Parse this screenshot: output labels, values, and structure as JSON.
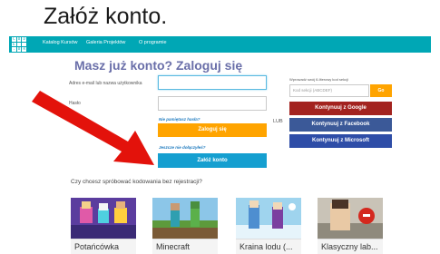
{
  "slide": {
    "title": "Załóż konto."
  },
  "nav": {
    "logo_letters": [
      "C",
      "O",
      "D",
      "E",
      "",
      "",
      ".",
      "O",
      "R"
    ],
    "items": [
      "Katalog Kursów",
      "Galeria Projektów",
      "O programie"
    ]
  },
  "login": {
    "heading": "Masz już konto? Zaloguj się",
    "email_label": "Adres e-mail lub nazwa użytkownika",
    "password_label": "Hasło",
    "forgot_link": "Nie pamiętasz hasła?",
    "login_button": "Zaloguj się",
    "new_prompt": "Jeszcze nie dołączyłeś?",
    "signup_button": "Załóż konto"
  },
  "social": {
    "section_label": "Wprowadź swój 6-literowy kod sekcji",
    "code_placeholder": "Kod sekcji (ABCDEF)",
    "go_button": "Go",
    "google_button": "Kontynuuj z Google",
    "facebook_button": "Kontynuuj z Facebook",
    "microsoft_button": "Kontynuuj z Microsoft",
    "or_label": "LUB"
  },
  "courses": {
    "question": "Czy chcesz spróbować kodowania bez rejestracji?",
    "cards": [
      {
        "title": "Potańcówka",
        "thumb_color": "#6b3fa0"
      },
      {
        "title": "Minecraft",
        "thumb_color": "#4d8a3b"
      },
      {
        "title": "Kraina lodu (...",
        "thumb_color": "#6fb7d8"
      },
      {
        "title": "Klasyczny lab...",
        "thumb_color": "#7a8c6a"
      }
    ]
  },
  "colors": {
    "topbar": "#00a7b5",
    "heading": "#6a6fa9",
    "orange": "#ffa400",
    "teal": "#159fd0",
    "google": "#a3231f",
    "facebook": "#3b5998",
    "microsoft": "#2e4da7",
    "arrow": "#e3120b"
  }
}
